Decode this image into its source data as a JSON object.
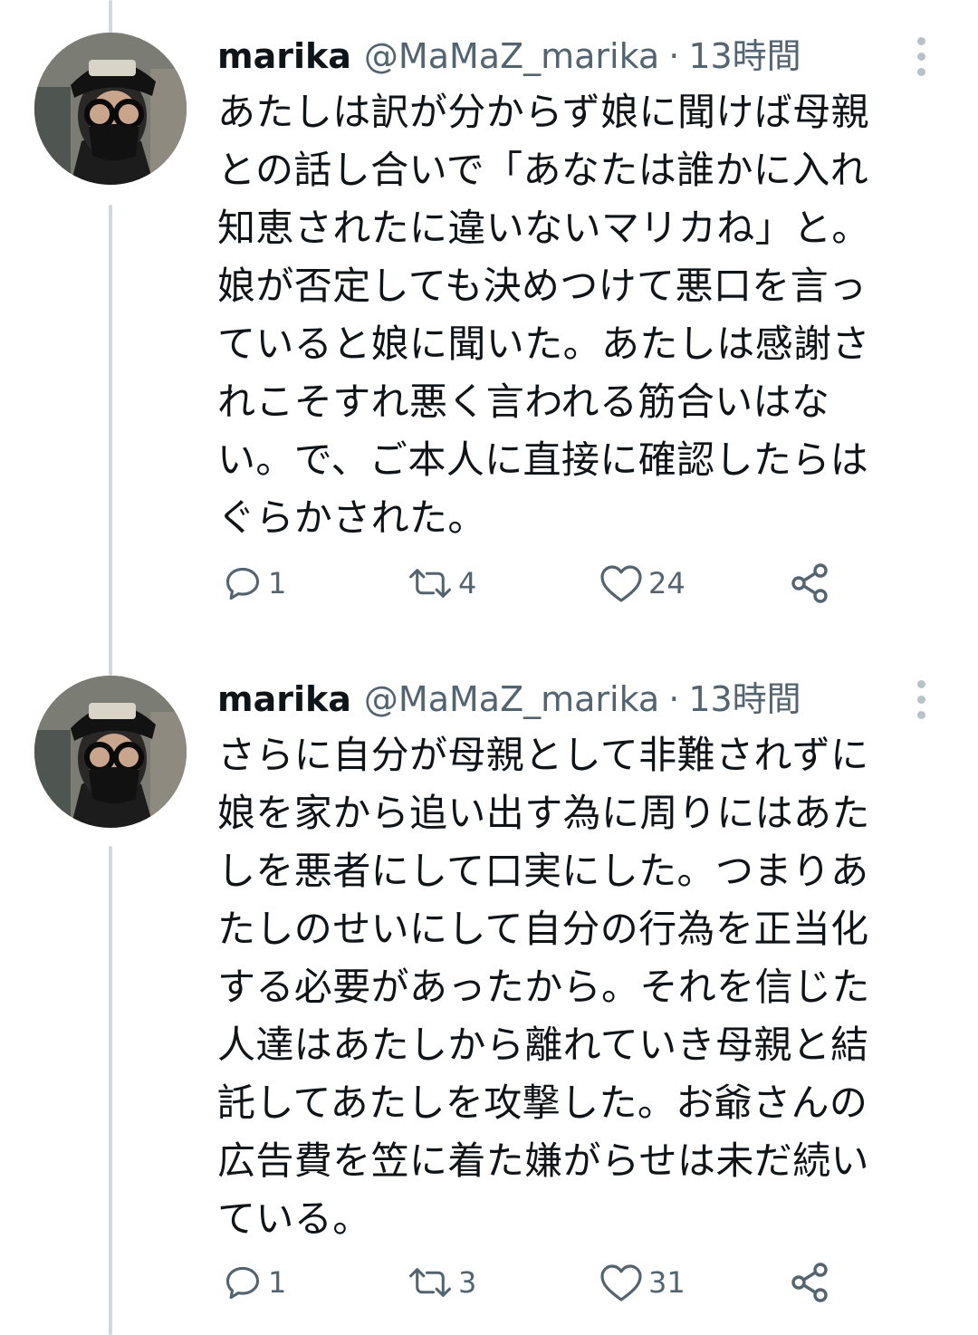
{
  "tweets": [
    {
      "author": {
        "name": "marika",
        "handle": "@MaMaZ_marika",
        "time": "13時間",
        "separator": "·"
      },
      "text": "あたしは訳が分からず娘に聞けば母親\nとの話し合いで「あなたは誰かに入れ\n知恵されたに違いないマリカね」と。\n娘が否定しても決めつけて悪口を言っ\nていると娘に聞いた。あたしは感謝さ\nれこそすれ悪く言われる筋合いはな\nい。で、ご本人に直接に確認したらは\nぐらかされた。",
      "stats": {
        "replies": "1",
        "retweets": "4",
        "likes": "24"
      }
    },
    {
      "author": {
        "name": "marika",
        "handle": "@MaMaZ_marika",
        "time": "13時間",
        "separator": "·"
      },
      "text": "さらに自分が母親として非難されずに\n娘を家から追い出す為に周りにはあた\nしを悪者にして口実にした。つまりあ\nたしのせいにして自分の行為を正当化\nする必要があったから。それを信じた\n人達はあたしから離れていき母親と結\n託してあたしを攻撃した。お爺さんの\n広告費を笠に着た嫌がらせは未だ続い\nている。",
      "stats": {
        "replies": "1",
        "retweets": "3",
        "likes": "31"
      }
    }
  ],
  "icons": {
    "avatar": "avatar-icon",
    "more": "more-vertical-icon",
    "reply": "reply-icon",
    "retweet": "retweet-icon",
    "like": "heart-icon",
    "share": "share-icon"
  },
  "colors": {
    "text": "#0f1419",
    "secondary": "#536471",
    "thread_line": "#cfd9de",
    "background": "#ffffff"
  }
}
